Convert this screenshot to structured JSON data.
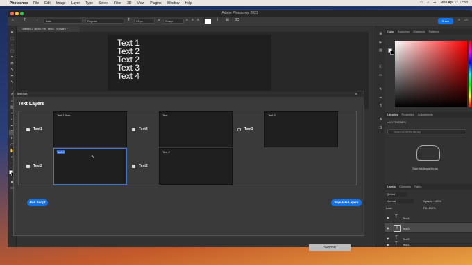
{
  "menubar": {
    "app": "Photoshop",
    "items": [
      "File",
      "Edit",
      "Image",
      "Layer",
      "Type",
      "Select",
      "Filter",
      "3D",
      "View",
      "Plugins",
      "Window",
      "Help"
    ],
    "clock": "Mon Apr 17 12:53"
  },
  "window": {
    "title": "Adobe Photoshop 2023",
    "doc_tab": "Untitled-1 @ 66.7% (Text2, RGB/8*) *"
  },
  "options": {
    "font": "Lato",
    "style": "Regular",
    "size": "33 px",
    "aa": "Sharp",
    "share": "Share"
  },
  "canvas": {
    "lines": [
      "Text 1",
      "Text 2",
      "Text 2",
      "Text 3",
      "Text 4"
    ]
  },
  "text_edit": {
    "panel_tab": "Text Edit",
    "title": "Text Layers",
    "cells": [
      {
        "label": "Text1",
        "value": "Text 1 fixer",
        "checked": true
      },
      {
        "label": "Text4",
        "value": "Text",
        "checked": true
      },
      {
        "label": "Text3",
        "value": "Text 3",
        "checked": false
      },
      {
        "label": "Text2",
        "value": "Text 2",
        "checked": true
      },
      {
        "label": "Text2",
        "value": "Text 2",
        "checked": true
      }
    ],
    "run_button": "Run Script",
    "populate_button": "Populate Layers"
  },
  "right_panels": {
    "color_tabs": [
      "Color",
      "Swatches",
      "Gradients",
      "Patterns"
    ],
    "lib_tabs": [
      "Libraries",
      "Properties",
      "Adjustments"
    ],
    "lib_name": "MY THEMES",
    "lib_search": "Search Current library",
    "lib_empty": "Start Adding a library",
    "layer_tabs": [
      "Layers",
      "Channels",
      "Paths"
    ],
    "kind": "Q Kind",
    "blend": "Normal",
    "opacity_label": "Opacity:",
    "opacity": "100%",
    "lock_label": "Lock:",
    "fill_label": "Fill:",
    "fill": "100%",
    "layers": [
      "Text4",
      "Text3",
      "Text2",
      "Text1"
    ]
  },
  "support": "Support",
  "colors": {
    "accent": "#1473e6",
    "panel": "#3a3a3a",
    "dark": "#1f1f1f"
  }
}
